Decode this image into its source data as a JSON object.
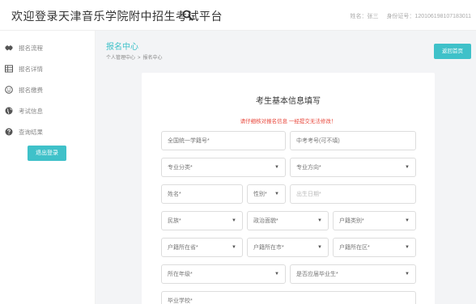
{
  "header": {
    "title": "欢迎登录天津音乐学院附中招生考试平台",
    "user_name": "姓名：张三",
    "id_number": "身份证号：120106198107183011"
  },
  "sidebar": {
    "items": [
      {
        "label": "报名流程",
        "icon": "handshake-icon"
      },
      {
        "label": "报名详情",
        "icon": "table-icon"
      },
      {
        "label": "报名缴费",
        "icon": "smile-icon"
      },
      {
        "label": "考试信息",
        "icon": "globe-icon"
      },
      {
        "label": "查询结果",
        "icon": "question-icon"
      }
    ],
    "logout_label": "退出登录"
  },
  "main": {
    "title": "报名中心",
    "breadcrumb": [
      "个人管理中心",
      "报名中心"
    ],
    "breadcrumb_sep": ">",
    "back_label": "返回首页"
  },
  "form": {
    "title": "考生基本信息填写",
    "warning": "请仔细核对报名信息 一经提交无法修改！",
    "fields": {
      "student_id": "全国统一学籍号*",
      "exam_number": "中考考号(可不填)",
      "major_category": "专业分类*",
      "major_direction": "专业方向*",
      "name": "姓名*",
      "gender": "性别*",
      "birth_date": "出生日期*",
      "ethnicity": "民族*",
      "political_status": "政治面貌*",
      "hukou_type": "户籍类别*",
      "hukou_province": "户籍所在省*",
      "hukou_city": "户籍所在市*",
      "hukou_district": "户籍所在区*",
      "grade": "所在年级*",
      "is_graduate": "是否应届毕业生*",
      "school": "毕业学校*"
    }
  },
  "colors": {
    "accent": "#3fc1c9",
    "warning": "#e8473b",
    "background": "#f3f4f6"
  }
}
